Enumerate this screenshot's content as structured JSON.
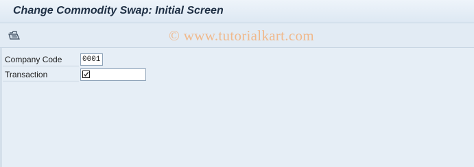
{
  "window": {
    "title": "Change Commodity Swap: Initial Screen"
  },
  "toolbar": {
    "icon": "open-folder-icon"
  },
  "watermark": "© www.tutorialkart.com",
  "form": {
    "company_code": {
      "label": "Company Code",
      "value": "0001"
    },
    "transaction": {
      "label": "Transaction",
      "value": "",
      "icon": "checkbox-required-icon"
    }
  },
  "colors": {
    "background": "#e6eef6",
    "watermark": "#f0b98c",
    "title": "#1e2f44"
  }
}
